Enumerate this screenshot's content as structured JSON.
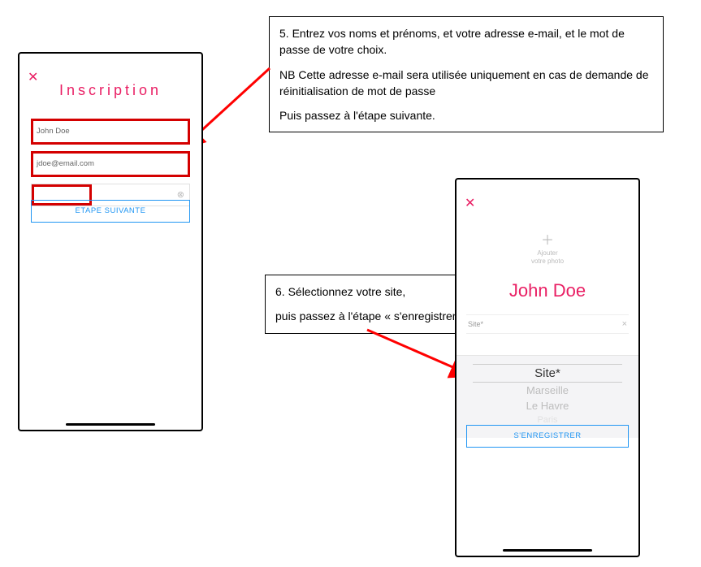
{
  "instruction5": {
    "p1": "5. Entrez vos noms et prénoms, et votre adresse e-mail, et le mot de passe de votre choix.",
    "p2": "NB Cette adresse e-mail sera utilisée uniquement en cas de demande de réinitialisation de mot de passe",
    "p3": "Puis passez à l'étape suivante."
  },
  "instruction6": {
    "p1": "6. Sélectionnez votre site,",
    "p2": "puis passez à l'étape « s'enregistrer »"
  },
  "phone1": {
    "title": "Inscription",
    "name_value": "John Doe",
    "email_value": "jdoe@email.com",
    "password_value": "",
    "next_button": "ETAPE SUIVANTE"
  },
  "phone2": {
    "add_photo_line1": "Ajouter",
    "add_photo_line2": "votre photo",
    "username": "John Doe",
    "site_label": "Site*",
    "picker": {
      "selected": "Site*",
      "option1": "Marseille",
      "option2": "Le Havre",
      "option3": "Paris"
    },
    "register_button": "S'ENREGISTRER"
  }
}
